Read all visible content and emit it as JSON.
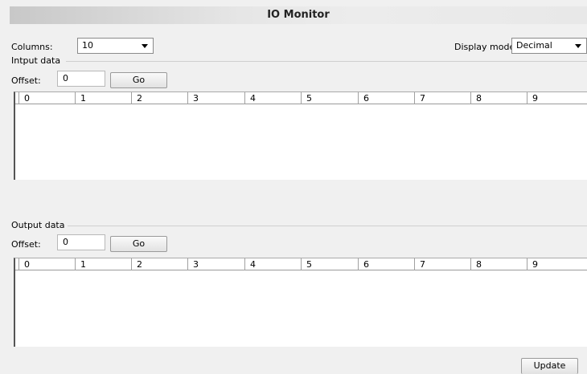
{
  "window": {
    "title": "IO Monitor"
  },
  "columns": {
    "label": "Columns:",
    "value": "10"
  },
  "display_mode": {
    "label": "Display mode:",
    "value": "Decimal"
  },
  "input": {
    "group_label": "Intput data",
    "offset_label": "Offset:",
    "offset_value": "0",
    "go_label": "Go",
    "headers": [
      "0",
      "1",
      "2",
      "3",
      "4",
      "5",
      "6",
      "7",
      "8",
      "9"
    ]
  },
  "output": {
    "group_label": "Output data",
    "offset_label": "Offset:",
    "offset_value": "0",
    "go_label": "Go",
    "headers": [
      "0",
      "1",
      "2",
      "3",
      "4",
      "5",
      "6",
      "7",
      "8",
      "9"
    ]
  },
  "update_label": "Update"
}
